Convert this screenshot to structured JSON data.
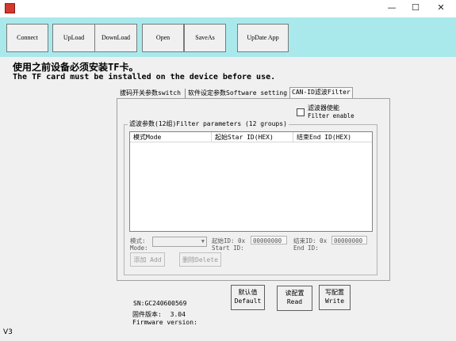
{
  "window": {
    "minimize": "—",
    "maximize": "☐",
    "close": "✕"
  },
  "toolbar": {
    "connect": "Connect",
    "upload": "UpLoad",
    "download": "DownLoad",
    "open": "Open",
    "saveas": "SaveAs",
    "update_app": "UpDate App"
  },
  "notice": {
    "zh": "使用之前设备必须安装TF卡。",
    "en": "The TF card must be installed on the device before use."
  },
  "tabs": [
    {
      "label": "拔码开关参数switch"
    },
    {
      "label": "软件设定参数Software setting"
    },
    {
      "label": "CAN-ID滤波Filter"
    }
  ],
  "filter": {
    "enable_zh": "滤波器使能",
    "enable_en": "Filter enable",
    "enabled": false,
    "group_title": "滤波参数(12组)Filter parameters (12 groups)",
    "columns": [
      "模式Mode",
      "起始Star ID(HEX)",
      "结束End ID(HEX)"
    ],
    "mode_zh": "模式:",
    "mode_en": "Mode:",
    "mode_value": "",
    "start_zh": "起始ID: 0x",
    "start_en": "Start ID:",
    "start_value": "00000000",
    "end_zh": "结束ID: 0x",
    "end_en": "End ID:",
    "end_value": "00000000",
    "add": "添加 Add",
    "delete": "删除Delete"
  },
  "buttons": {
    "default_zh": "默认值",
    "default_en": "Default",
    "read_zh": "读配置",
    "read_en": "Read",
    "write_zh": "写配置",
    "write_en": "Write"
  },
  "device": {
    "sn": "SN:GC240600569",
    "fw_zh": "固件版本:",
    "fw_value": "3.04",
    "fw_en": "Firmware version:"
  },
  "status": {
    "version": "V3"
  }
}
